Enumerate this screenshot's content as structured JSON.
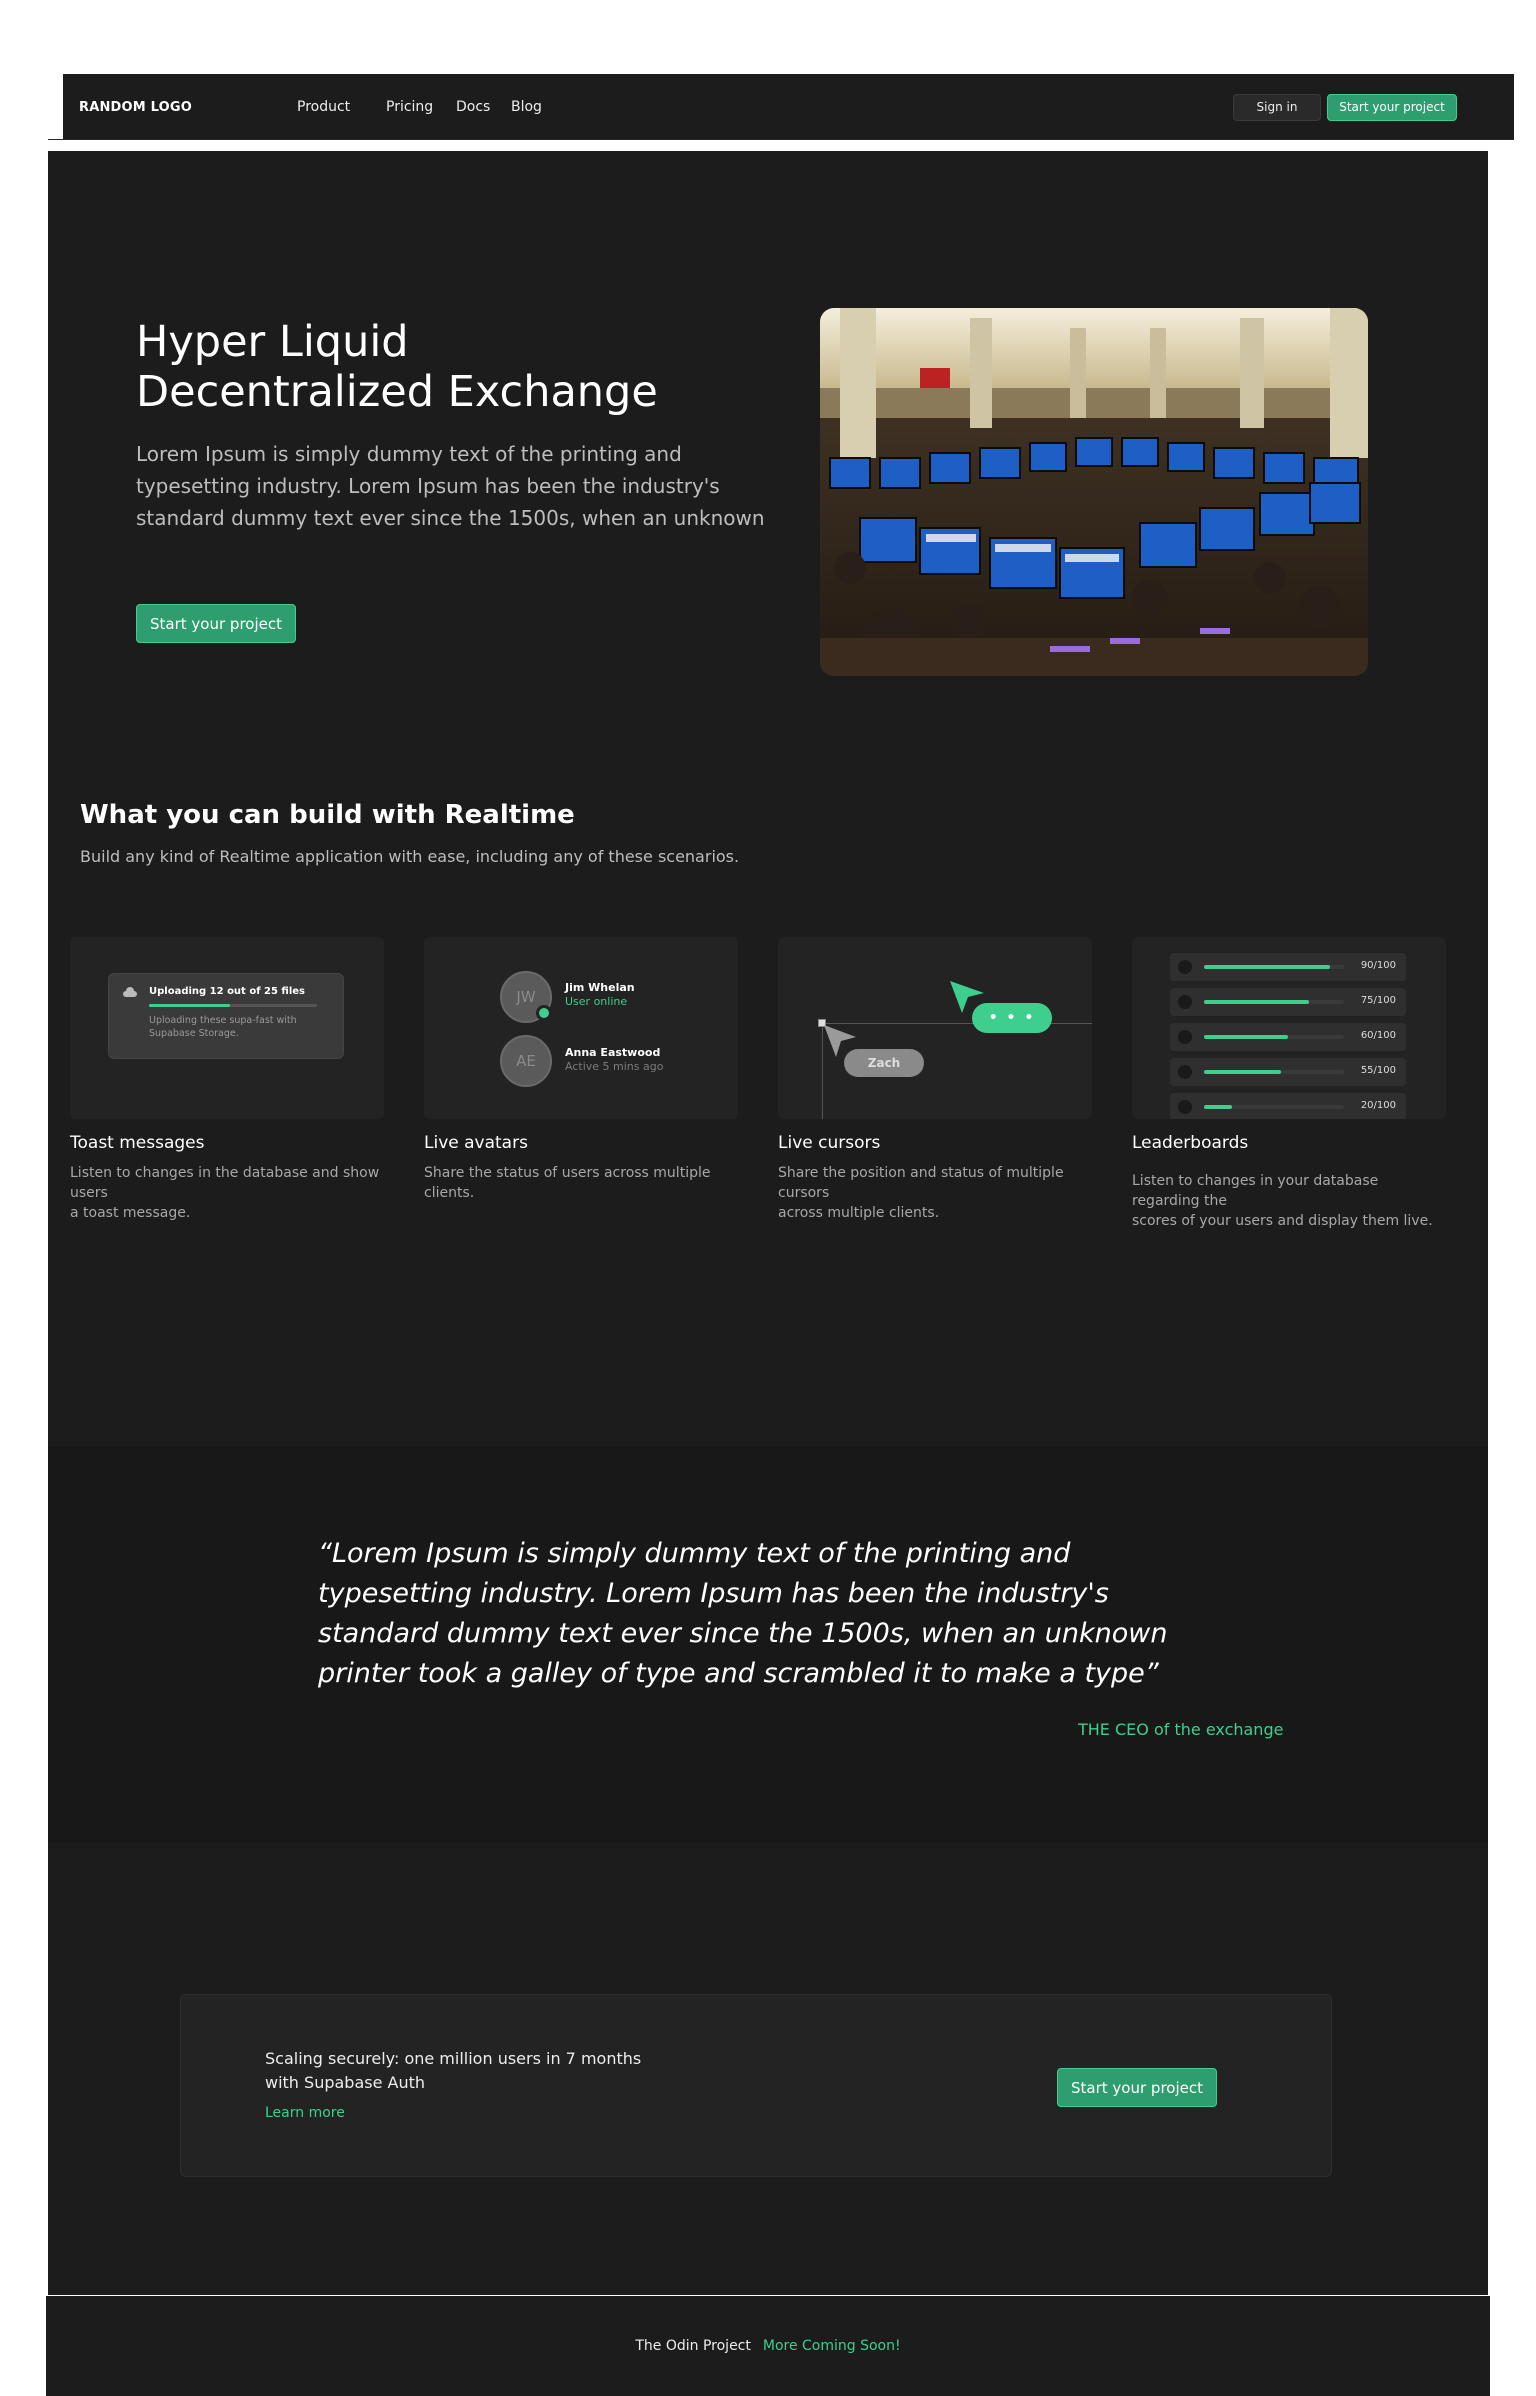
{
  "nav": {
    "logo": "RANDOM LOGO",
    "links": [
      "Product",
      "Pricing",
      "Docs",
      "Blog"
    ],
    "signin": "Sign in",
    "start": "Start your project"
  },
  "hero": {
    "title_line1": "Hyper Liquid",
    "title_line2": "Decentralized Exchange",
    "text_line1": "Lorem Ipsum is simply dummy text of the printing and",
    "text_line2": "typesetting industry. Lorem Ipsum has been the industry's",
    "text_line3": "standard dummy text ever since the 1500s, when an unknown",
    "button": "Start your project"
  },
  "features": {
    "title": "What you can build with Realtime",
    "subtitle": "Build any kind of Realtime application with ease, including any of these scenarios.",
    "toast": {
      "title": "Toast messages",
      "desc": [
        "Listen to changes in the database and show users",
        "a toast message."
      ],
      "demo_title": "Uploading 12 out of 25 files",
      "demo_progress": 0.48,
      "demo_text": "Uploading these supa-fast with Supabase Storage."
    },
    "avatars": {
      "title": "Live avatars",
      "desc": [
        "Share the status of users across multiple clients."
      ],
      "users": [
        {
          "initials": "JW",
          "name": "Jim Whelan",
          "status": "User online",
          "status_color": "#3ecf8e"
        },
        {
          "initials": "AE",
          "name": "Anna Eastwood",
          "status": "Active 5 mins ago",
          "status_color": "#7a7a7a"
        }
      ]
    },
    "cursors": {
      "title": "Live cursors",
      "desc": [
        "Share the position and status of multiple cursors",
        "across multiple clients."
      ],
      "bubble_green": "• • •",
      "bubble_gray": "Zach"
    },
    "leaderboards": {
      "title": "Leaderboards",
      "desc": [
        "Listen to changes in your database regarding the",
        "scores of your users and display them live."
      ],
      "scores": [
        {
          "label": "90/100",
          "value": 0.9
        },
        {
          "label": "75/100",
          "value": 0.75
        },
        {
          "label": "60/100",
          "value": 0.6
        },
        {
          "label": "55/100",
          "value": 0.55
        },
        {
          "label": "20/100",
          "value": 0.2
        }
      ]
    }
  },
  "quote": {
    "line1": "“Lorem Ipsum is simply dummy text of the printing and",
    "line2": "typesetting industry. Lorem Ipsum has been the industry's",
    "line3": "standard dummy text ever since the 1500s, when an unknown",
    "line4": "printer took a galley of type and scrambled it to make a type”",
    "author": "THE CEO of the exchange"
  },
  "cta": {
    "title_line1": "Scaling securely: one million users in 7 months",
    "title_line2": "with Supabase Auth",
    "link": "Learn more",
    "button": "Start your project"
  },
  "footer": {
    "text": "The Odin Project",
    "highlight": "More Coming Soon!"
  },
  "colors": {
    "accent": "#3ecf8e",
    "button_bg": "#2f9e6e",
    "background": "#1c1c1c",
    "card": "#232323"
  }
}
